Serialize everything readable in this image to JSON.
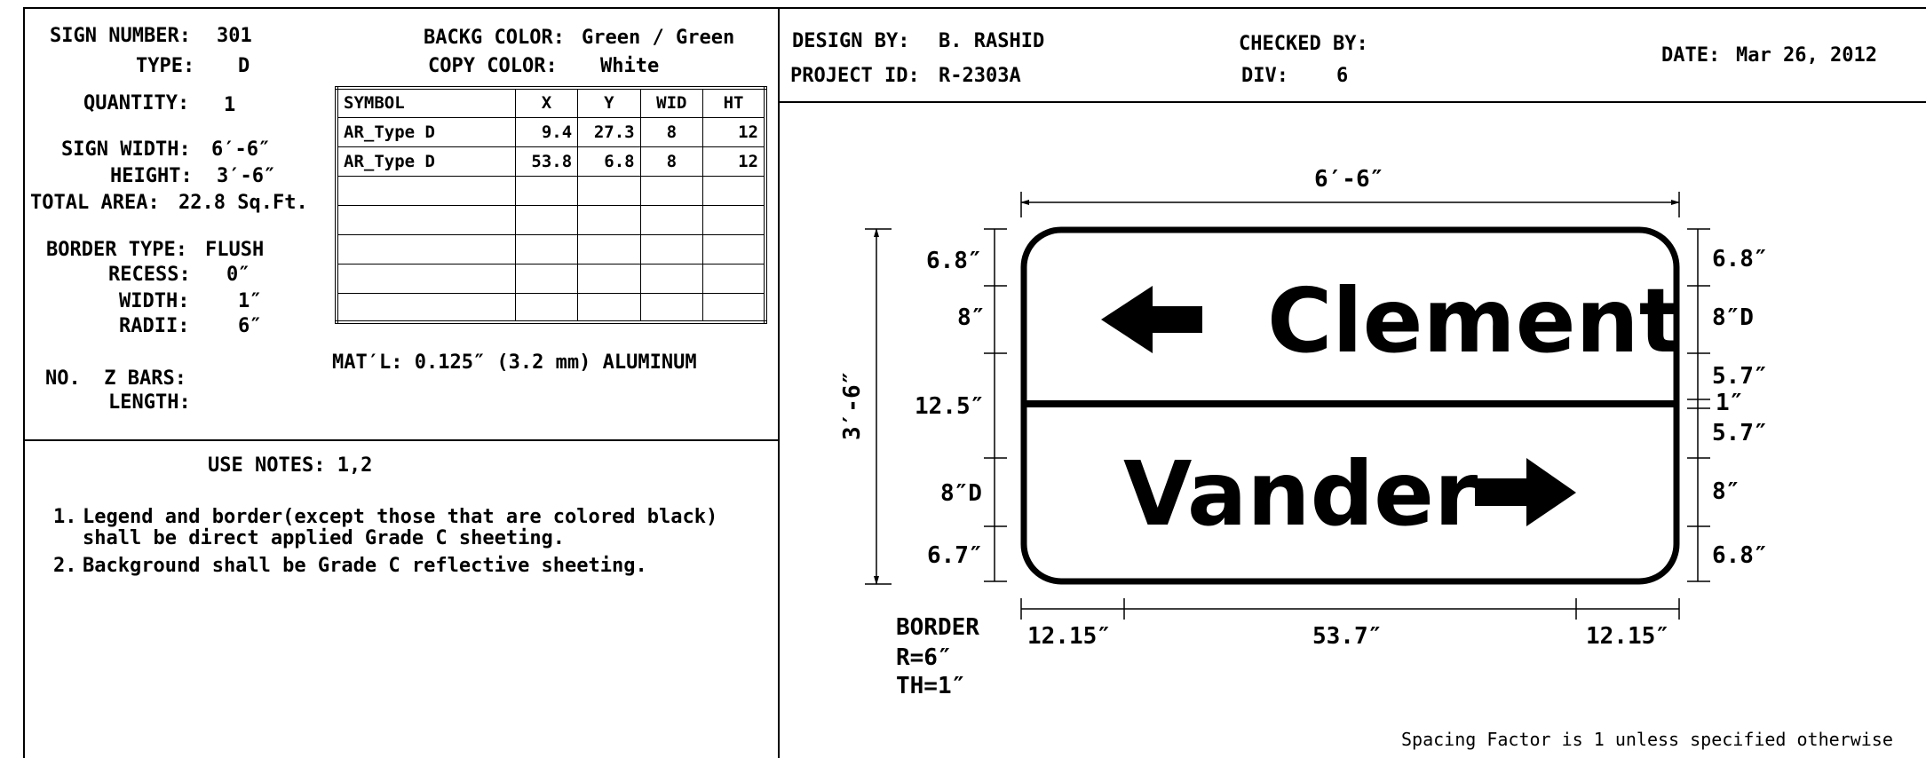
{
  "left_panel": {
    "sign_number": {
      "label": "SIGN NUMBER:",
      "value": "301"
    },
    "type": {
      "label": "TYPE:",
      "value": "D"
    },
    "quantity": {
      "label": "QUANTITY:",
      "value": "1"
    },
    "sign_width": {
      "label": "SIGN WIDTH:",
      "value": "6′-6″"
    },
    "height": {
      "label": "HEIGHT:",
      "value": "3′-6″"
    },
    "total_area": {
      "label": "TOTAL AREA:",
      "value": "22.8 Sq.Ft."
    },
    "border_type": {
      "label": "BORDER TYPE:",
      "value": "FLUSH"
    },
    "recess": {
      "label": "RECESS:",
      "value": "0″"
    },
    "width": {
      "label": "WIDTH:",
      "value": "1″"
    },
    "radii": {
      "label": "RADII:",
      "value": "6″"
    },
    "z_bars": {
      "label": "NO.  Z BARS:"
    },
    "length": {
      "label": "LENGTH:"
    },
    "backg_color": {
      "label": "BACKG COLOR:",
      "value": "Green / Green"
    },
    "copy_color": {
      "label": "COPY COLOR:",
      "value": "White"
    },
    "material": "MAT′L: 0.125″ (3.2 mm) ALUMINUM"
  },
  "symbol_table": {
    "headers": [
      "SYMBOL",
      "X",
      "Y",
      "WID",
      "HT"
    ],
    "rows": [
      [
        "AR_Type D",
        "9.4",
        "27.3",
        "8",
        "12"
      ],
      [
        "AR_Type D",
        "53.8",
        "6.8",
        "8",
        "12"
      ]
    ]
  },
  "use_notes": {
    "title": "USE NOTES: 1,2",
    "items": [
      {
        "num": "1.",
        "text": "Legend and border(except those that are colored black)",
        "cont": "shall be direct applied Grade C sheeting."
      },
      {
        "num": "2.",
        "text": "Background shall be Grade C reflective sheeting."
      }
    ]
  },
  "header": {
    "design_by": {
      "label": "DESIGN BY:",
      "value": "B. RASHID"
    },
    "project_id": {
      "label": "PROJECT ID:",
      "value": "R-2303A"
    },
    "checked_by": {
      "label": "CHECKED BY:"
    },
    "div": {
      "label": "DIV:",
      "value": "6"
    },
    "date": {
      "label": "DATE:",
      "value": "Mar 26, 2012"
    }
  },
  "sign": {
    "top_legend": "Clement",
    "bottom_legend": "Vander",
    "width_dim": "6′-6″",
    "height_dim": "3′-6″",
    "left_dims": [
      "6.8″",
      "8″",
      "12.5″",
      "8″D",
      "6.7″"
    ],
    "right_dims": [
      "6.8″",
      "8″D",
      "5.7″",
      "1″",
      "5.7″",
      "8″",
      "6.8″"
    ],
    "bottom_dims": [
      "12.15″",
      "53.7″",
      "12.15″"
    ],
    "border_note": [
      "BORDER",
      "R=6″",
      "TH=1″"
    ]
  },
  "footer_note": "Spacing Factor is 1 unless specified otherwise"
}
